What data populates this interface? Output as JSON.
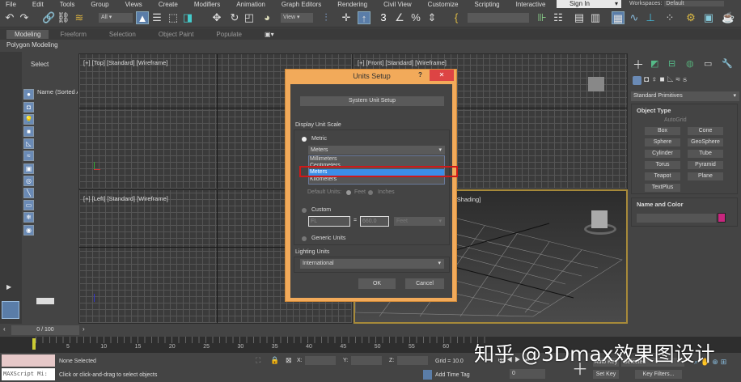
{
  "menu": [
    "File",
    "Edit",
    "Tools",
    "Group",
    "Views",
    "Create",
    "Modifiers",
    "Animation",
    "Graph Editors",
    "Rendering",
    "Civil View",
    "Customize",
    "Scripting",
    "Interactive"
  ],
  "sign_in": "Sign In",
  "workspaces_label": "Workspaces:",
  "workspace_value": "Default",
  "toolbar": {
    "filter": "All",
    "ref_coord": "View"
  },
  "ribbon_tabs": [
    "Modeling",
    "Freeform",
    "Selection",
    "Object Paint",
    "Populate"
  ],
  "ribbon_panel": "Polygon Modeling",
  "explorer": {
    "select": "Select",
    "column": "Name (Sorted A"
  },
  "viewports": {
    "top": "[+] [Top] [Standard] [Wireframe]",
    "front": "[+] [Front] [Standard] [Wireframe]",
    "left": "[+] [Left] [Standard] [Wireframe]",
    "perspective": "[+] [Perspective] [Standard] [Default Shading]"
  },
  "right_panel": {
    "category": "Standard Primitives",
    "object_type": "Object Type",
    "autogrid": "AutoGrid",
    "buttons": [
      "Box",
      "Cone",
      "Sphere",
      "GeoSphere",
      "Cylinder",
      "Tube",
      "Torus",
      "Pyramid",
      "Teapot",
      "Plane",
      "TextPlus"
    ],
    "name_and_color": "Name and Color",
    "color": "#c8267e"
  },
  "dialog": {
    "title": "Units Setup",
    "help": "?",
    "close": "✕",
    "system_unit_setup": "System Unit Setup",
    "display_unit_scale": "Display Unit Scale",
    "metric": "Metric",
    "metric_value": "Meters",
    "metric_options": [
      "Millimeters",
      "Centimeters",
      "Meters",
      "Kilometers"
    ],
    "default_units": "Default Units:",
    "feet": "Feet",
    "inches": "Inches",
    "custom": "Custom",
    "custom_value": "FL",
    "custom_equals": "=",
    "custom_amount": "660.0",
    "custom_unit": "Feet",
    "generic_units": "Generic Units",
    "lighting_units": "Lighting Units",
    "lighting_value": "International",
    "ok": "OK",
    "cancel": "Cancel"
  },
  "time_slider": "0 / 100",
  "track_ticks": [
    "5",
    "10",
    "15",
    "20",
    "25",
    "30",
    "35",
    "40",
    "45",
    "50",
    "55",
    "60"
  ],
  "status": {
    "maxscript": "MAXScript Mi:",
    "selection": "None Selected",
    "prompt": "Click or click-and-drag to select objects",
    "x_label": "X:",
    "y_label": "Y:",
    "z_label": "Z:",
    "grid": "Grid = 10.0",
    "add_time_tag": "Add Time Tag",
    "auto_key": "Auto Key",
    "selected": "Selected",
    "set_key": "Set Key",
    "key_filters": "Key Filters...",
    "frame": "0"
  },
  "watermark": "知乎 @3Dmax效果图设计"
}
